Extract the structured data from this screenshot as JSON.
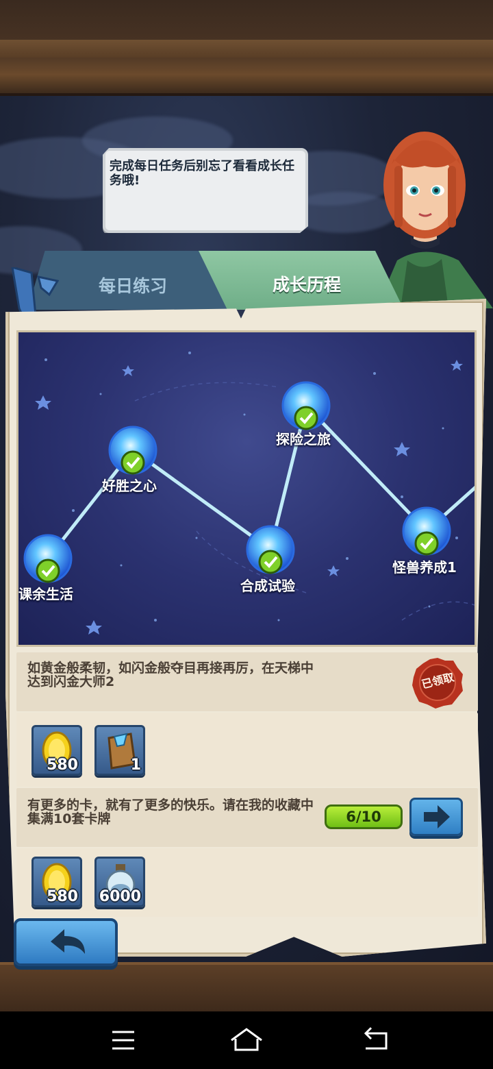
{
  "bubble": {
    "text": "完成每日任务后别忘了看看成长任务哦!"
  },
  "tabs": [
    {
      "label": "每日练习",
      "active": false
    },
    {
      "label": "成长历程",
      "active": true
    }
  ],
  "star_map": {
    "nodes": [
      {
        "label": "课余生活",
        "completed": true
      },
      {
        "label": "好胜之心",
        "completed": true
      },
      {
        "label": "合成试验",
        "completed": true
      },
      {
        "label": "探险之旅",
        "completed": true
      },
      {
        "label": "怪兽养成1",
        "completed": true
      }
    ]
  },
  "tasks": [
    {
      "text": "如黄金般柔韧，如闪金般夺目再接再厉，在天梯中达到闪金大师2",
      "status_seal": "已领取",
      "rewards": [
        {
          "icon": "gold-coin-icon",
          "qty": "580"
        },
        {
          "icon": "card-pack-icon",
          "qty": "1"
        }
      ]
    },
    {
      "text": "有更多的卡，就有了更多的快乐。请在我的收藏中集满10套卡牌",
      "progress": "6/10",
      "progress_fraction": 0.6,
      "rewards": [
        {
          "icon": "gold-coin-icon",
          "qty": "580"
        },
        {
          "icon": "dust-bottle-icon",
          "qty": "6000"
        }
      ]
    }
  ],
  "colors": {
    "tab_active": "#7fbb95",
    "tab_inactive": "#3d5f7a",
    "progress_fill": "#8fd626",
    "seal": "#b8321f",
    "button_blue": "#3a8ad0"
  }
}
